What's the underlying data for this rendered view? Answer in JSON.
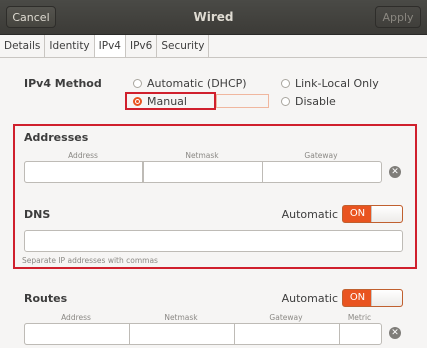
{
  "titlebar": {
    "cancel": "Cancel",
    "title": "Wired",
    "apply": "Apply"
  },
  "tabs": [
    "Details",
    "Identity",
    "IPv4",
    "IPv6",
    "Security"
  ],
  "ipv4": {
    "method_label": "IPv4 Method",
    "options": {
      "dhcp": "Automatic (DHCP)",
      "link_local": "Link-Local Only",
      "manual": "Manual",
      "disable": "Disable"
    },
    "selected": "Manual"
  },
  "addresses": {
    "label": "Addresses",
    "columns": [
      "Address",
      "Netmask",
      "Gateway"
    ]
  },
  "dns": {
    "label": "DNS",
    "automatic_label": "Automatic",
    "switch_state": "ON",
    "hint": "Separate IP addresses with commas"
  },
  "routes": {
    "label": "Routes",
    "automatic_label": "Automatic",
    "switch_state": "ON",
    "columns": [
      "Address",
      "Netmask",
      "Gateway",
      "Metric"
    ]
  },
  "colors": {
    "accent": "#e95420",
    "highlight": "#d0202d",
    "titlebar": "#3c3b37"
  }
}
